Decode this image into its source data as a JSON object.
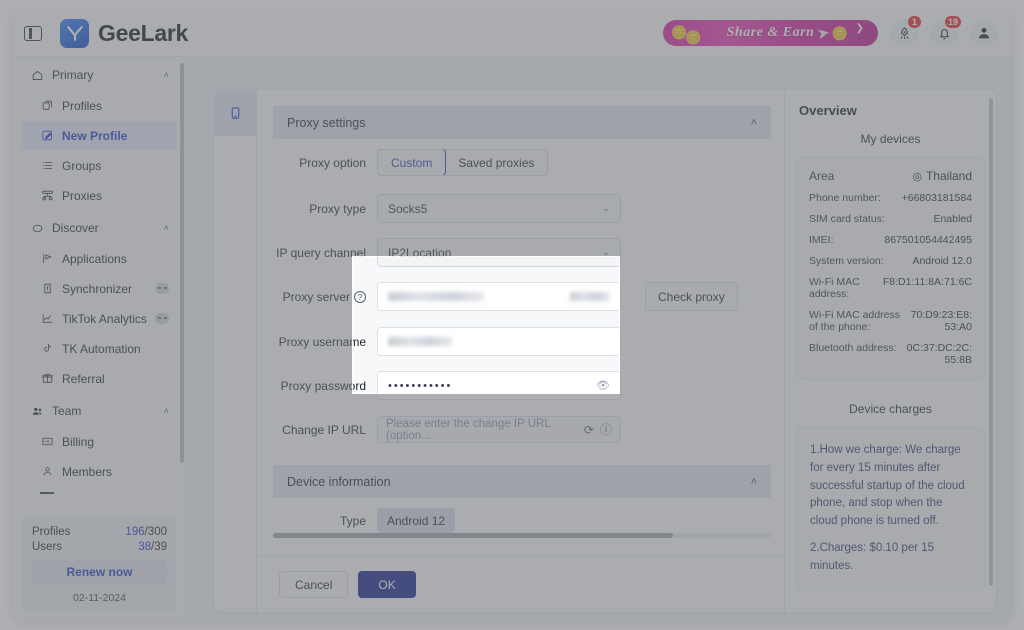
{
  "topbar": {
    "panel_toggle_icon": "panel-toggle-icon",
    "brand_name": "GeeLark",
    "share_earn_label": "Share & Earn",
    "rocket_badge": "1",
    "bell_badge": "19"
  },
  "sidebar": {
    "groups": [
      {
        "label": "Primary",
        "icon": "home-icon",
        "collapsed_chevron": "˄",
        "items": [
          {
            "label": "Profiles",
            "icon": "profiles-icon",
            "active": false
          },
          {
            "label": "New Profile",
            "icon": "new-profile-icon",
            "active": true
          },
          {
            "label": "Groups",
            "icon": "groups-icon",
            "active": false
          },
          {
            "label": "Proxies",
            "icon": "proxies-icon",
            "active": false
          }
        ]
      },
      {
        "label": "Discover",
        "icon": "discover-icon",
        "collapsed_chevron": "˄",
        "items": [
          {
            "label": "Applications",
            "icon": "applications-icon",
            "active": false
          },
          {
            "label": "Synchronizer",
            "icon": "synchronizer-icon",
            "active": false,
            "toggle": true
          },
          {
            "label": "TikTok Analytics",
            "icon": "analytics-icon",
            "active": false,
            "toggle": true
          },
          {
            "label": "TK Automation",
            "icon": "tiktok-icon",
            "active": false
          },
          {
            "label": "Referral",
            "icon": "gift-icon",
            "active": false
          }
        ]
      },
      {
        "label": "Team",
        "icon": "team-icon",
        "collapsed_chevron": "˄",
        "items": [
          {
            "label": "Billing",
            "icon": "billing-icon",
            "active": false
          },
          {
            "label": "Members",
            "icon": "members-icon",
            "active": false
          }
        ]
      }
    ],
    "plan": {
      "profiles_label": "Profiles",
      "profiles_used": "196",
      "profiles_total": "/300",
      "users_label": "Users",
      "users_used": "38",
      "users_total": "/39",
      "renew_label": "Renew now",
      "date": "02-11-2024"
    }
  },
  "main": {
    "phone_tab_icon": "phone-icon",
    "proxy_section": {
      "title": "Proxy settings",
      "chevron": "˄",
      "proxy_option": {
        "label": "Proxy option",
        "options": [
          "Custom",
          "Saved proxies"
        ],
        "selected": "Custom"
      },
      "proxy_type": {
        "label": "Proxy type",
        "value": "Socks5",
        "chevron": "⌄"
      },
      "ip_query_channel": {
        "label": "IP query channel",
        "value": "IP2Location",
        "chevron": "⌄"
      },
      "proxy_server": {
        "label": "Proxy server",
        "help_icon": "question-icon",
        "value": "",
        "masked": true,
        "check_button": "Check proxy"
      },
      "proxy_username": {
        "label": "Proxy username",
        "value": "",
        "masked": true
      },
      "proxy_password": {
        "label": "Proxy password",
        "value": "•••••••••••",
        "eye_icon": "eye-off-icon"
      },
      "change_ip_url": {
        "label": "Change IP URL",
        "placeholder": "Please enter the change IP URL (option...",
        "refresh_icon": "refresh-icon",
        "info_icon": "info-icon",
        "value": ""
      }
    },
    "device_section": {
      "title": "Device information",
      "chevron": "˄",
      "type": {
        "label": "Type",
        "value": "Android 12"
      }
    },
    "footer": {
      "cancel": "Cancel",
      "ok": "OK"
    }
  },
  "overview": {
    "title": "Overview",
    "my_devices_title": "My devices",
    "device_rows": [
      {
        "key": "Area",
        "value": "Thailand",
        "icon": "location-pin-icon"
      },
      {
        "key": "Phone number:",
        "value": "+66803181584"
      },
      {
        "key": "SIM card status:",
        "value": "Enabled"
      },
      {
        "key": "IMEI:",
        "value": "867501054442495"
      },
      {
        "key": "System version:",
        "value": "Android 12.0"
      },
      {
        "key": "Wi-Fi MAC address:",
        "value": "F8:D1:11:8A:71:6C"
      },
      {
        "key": "Wi-Fi MAC address of the phone:",
        "value": "70:D9:23:E8:53:A0"
      },
      {
        "key": "Bluetooth address:",
        "value": "0C:37:DC:2C:55:8B"
      }
    ],
    "charges_title": "Device charges",
    "charges": [
      "1.How we charge: We charge for every 15 minutes after successful startup of the cloud phone, and stop when the cloud phone is turned off.",
      "2.Charges: $0.10 per 15 minutes."
    ]
  },
  "colors": {
    "accent_blue": "#1d39c4",
    "ok_button": "#13208c",
    "badge_red": "#e8262f",
    "section_header": "#dde1eb"
  }
}
